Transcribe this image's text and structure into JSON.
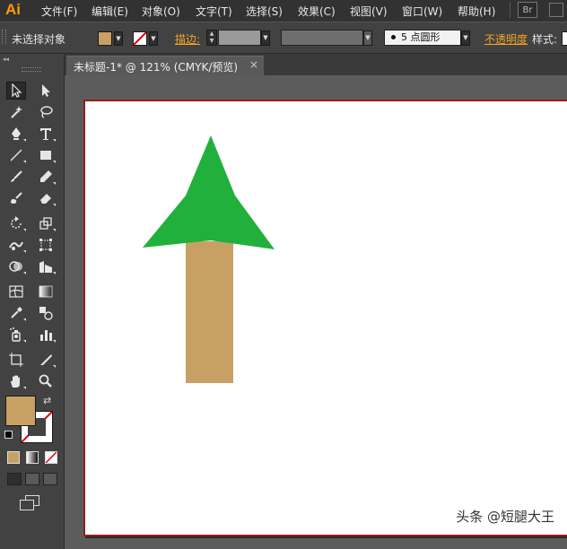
{
  "menubar": {
    "logo": "Ai",
    "items": [
      "文件(F)",
      "编辑(E)",
      "对象(O)",
      "文字(T)",
      "选择(S)",
      "效果(C)",
      "视图(V)",
      "窗口(W)",
      "帮助(H)"
    ],
    "bridge_label": "Br"
  },
  "controlbar": {
    "selection_status": "未选择对象",
    "stroke_label": "描边:",
    "brush_size": "5",
    "brush_shape": "点圆形",
    "opacity_label": "不透明度",
    "style_label": "样式:"
  },
  "tabbar": {
    "collapse_glyph": "◂◂",
    "doc_title": "未标题-1* @ 121% (CMYK/预览)",
    "close_glyph": "×"
  },
  "colors": {
    "fill": "#c9a063",
    "tree_crown": "#21b03b",
    "tree_trunk": "#c9a063",
    "artboard_border": "#9b1a1a",
    "accent": "#ff9a00"
  },
  "tools": [
    "selection-tool-icon",
    "direct-selection-tool-icon",
    "magic-wand-tool-icon",
    "lasso-tool-icon",
    "pen-tool-icon",
    "type-tool-icon",
    "line-segment-tool-icon",
    "rectangle-tool-icon",
    "paintbrush-tool-icon",
    "pencil-tool-icon",
    "blob-brush-tool-icon",
    "eraser-tool-icon",
    "rotate-tool-icon",
    "scale-tool-icon",
    "warp-tool-icon",
    "free-transform-tool-icon",
    "shape-builder-tool-icon",
    "perspective-grid-tool-icon",
    "mesh-tool-icon",
    "gradient-tool-icon",
    "eyedropper-tool-icon",
    "blend-tool-icon",
    "symbol-sprayer-tool-icon",
    "column-graph-tool-icon",
    "artboard-tool-icon",
    "slice-tool-icon",
    "hand-tool-icon",
    "zoom-tool-icon"
  ],
  "watermark": "头条 @短腿大王"
}
